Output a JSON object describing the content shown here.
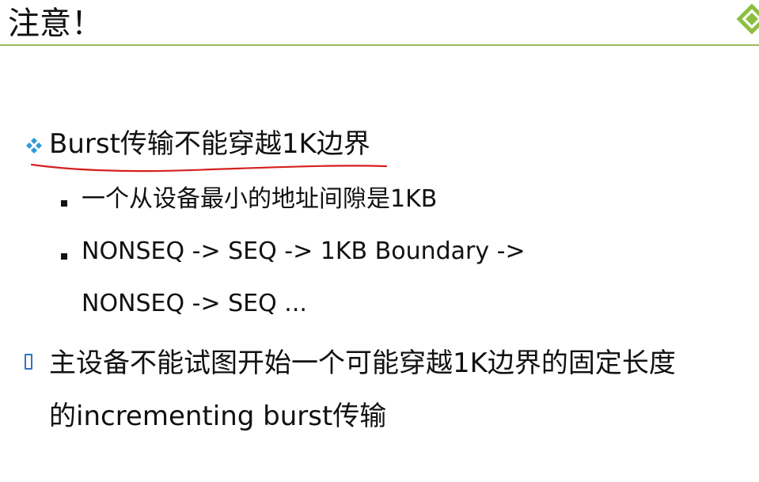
{
  "title": "注意！",
  "bullet1": "Burst传输不能穿越1K边界",
  "sub1": "一个从设备最小的地址间隙是1KB",
  "sub2_line1": "NONSEQ -> SEQ -> 1KB Boundary ->",
  "sub2_line2": "NONSEQ -> SEQ ...",
  "bullet2_line1": "主设备不能试图开始一个可能穿越1K边界的固定长度",
  "bullet2_line2": "的incrementing burst传输",
  "colors": {
    "accent_green": "#9bbb59",
    "bullet_blue": "#2e9ad6",
    "underline_red": "#d62020"
  }
}
